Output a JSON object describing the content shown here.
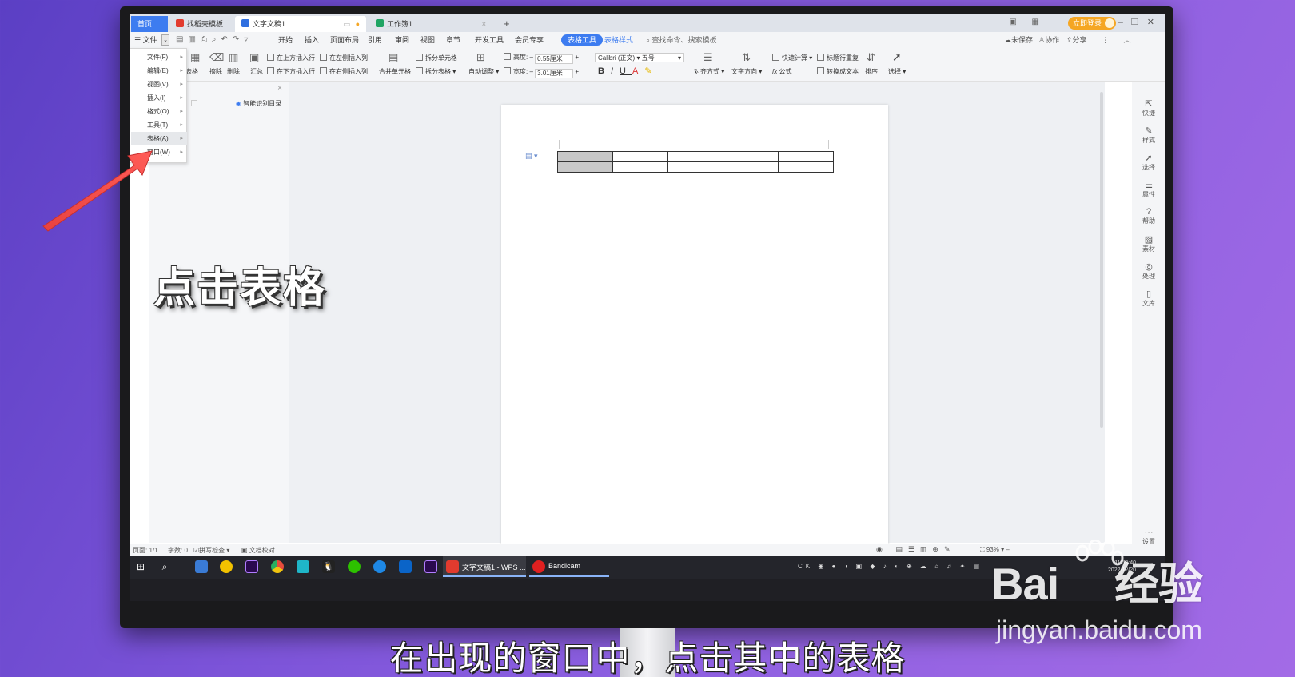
{
  "tabs": [
    {
      "label": "首页"
    },
    {
      "label": "找稻壳模板"
    },
    {
      "label": "文字文稿1"
    },
    {
      "label": "工作簿1"
    }
  ],
  "window": {
    "login": "立即登录",
    "new_tab": "+"
  },
  "menubar": {
    "file": "文件",
    "items": [
      "开始",
      "插入",
      "页面布局",
      "引用",
      "审阅",
      "视图",
      "章节",
      "开发工具",
      "会员专享"
    ],
    "table_tools": "表格工具",
    "table_style": "表格样式",
    "search": "查找命令、搜索模板",
    "right": [
      "未保存",
      "协作",
      "分享"
    ]
  },
  "ribbon": {
    "table": "表格",
    "erase": "擦除",
    "delete": "删除",
    "summary": "汇总",
    "insert_above": "在上方插入行",
    "insert_below": "在下方插入行",
    "insert_left": "在左侧插入列",
    "insert_right": "在右侧插入列",
    "merge": "合并单元格",
    "split_cell": "拆分单元格",
    "split_table": "拆分表格",
    "autofit": "自动调整",
    "height_label": "高度:",
    "height_value": "0.55厘米",
    "width_label": "宽度:",
    "width_value": "3.01厘米",
    "font": "Calibri (正文)",
    "size": "五号",
    "align": "对齐方式",
    "direction": "文字方向",
    "quick_calc": "快速计算",
    "repeat_header": "标题行重复",
    "convert_text": "转换成文本",
    "formula": "公式",
    "sort": "排序",
    "select": "选择"
  },
  "dropdown": {
    "items": [
      {
        "label": "文件(F)"
      },
      {
        "label": "编辑(E)"
      },
      {
        "label": "视图(V)"
      },
      {
        "label": "插入(I)"
      },
      {
        "label": "格式(O)"
      },
      {
        "label": "工具(T)"
      },
      {
        "label": "表格(A)"
      },
      {
        "label": "窗口(W)"
      }
    ],
    "highlighted_index": 6
  },
  "leftpanel": {
    "smart_toc": "智能识别目录"
  },
  "rightbar": [
    {
      "label": "快捷"
    },
    {
      "label": "样式"
    },
    {
      "label": "选择"
    },
    {
      "label": "属性"
    },
    {
      "label": "帮助"
    },
    {
      "label": "素材"
    },
    {
      "label": "处理"
    },
    {
      "label": "文库"
    },
    {
      "label": "设置"
    }
  ],
  "statusbar": {
    "page": "页面: 1/1",
    "words": "字数: 0",
    "spell": "拼写检查",
    "proof": "文档校对",
    "zoom": "93%"
  },
  "taskbar": {
    "wps_window": "文字文稿1 - WPS ...",
    "bandicam": "Bandicam",
    "tray": "CK",
    "time": "11:53:40",
    "date": "2022/12/20"
  },
  "overlay": {
    "caption": "点击表格",
    "subtitle": "在出现的窗口中，点击其中的表格"
  },
  "watermark": {
    "brand": "Bai",
    "brand2": "经验",
    "site": "jingyan.baidu.com"
  }
}
